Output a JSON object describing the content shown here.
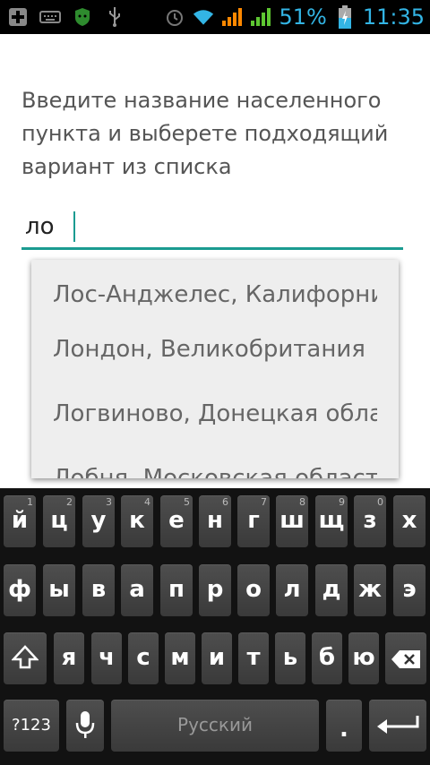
{
  "status_bar": {
    "battery_percent": "51%",
    "time": "11:35",
    "accent": "#33b5e5",
    "icons": [
      "add-icon",
      "keyboard-icon",
      "android-icon",
      "usb-icon",
      "alarm-icon",
      "wifi-icon",
      "signal-icon",
      "signal-icon",
      "battery-icon"
    ]
  },
  "instruction": "Введите название населенного пункта и выберете подходящий вариант из списка",
  "search": {
    "value": "ло",
    "accent": "#1b9b91"
  },
  "suggestions": [
    "Лос-Анджелес, Калифорния",
    "Лондон, Великобритания",
    "Логвиново, Донецкая область",
    "Лобня, Московская область"
  ],
  "keyboard": {
    "row1": [
      {
        "label": "й",
        "hint": "1"
      },
      {
        "label": "ц",
        "hint": "2"
      },
      {
        "label": "у",
        "hint": "3"
      },
      {
        "label": "к",
        "hint": "4"
      },
      {
        "label": "е",
        "hint": "5"
      },
      {
        "label": "н",
        "hint": "6"
      },
      {
        "label": "г",
        "hint": "7"
      },
      {
        "label": "ш",
        "hint": "8"
      },
      {
        "label": "щ",
        "hint": "9"
      },
      {
        "label": "з",
        "hint": "0"
      },
      {
        "label": "х",
        "hint": ""
      }
    ],
    "row2": [
      {
        "label": "ф"
      },
      {
        "label": "ы"
      },
      {
        "label": "в"
      },
      {
        "label": "а"
      },
      {
        "label": "п"
      },
      {
        "label": "р"
      },
      {
        "label": "о"
      },
      {
        "label": "л"
      },
      {
        "label": "д"
      },
      {
        "label": "ж"
      },
      {
        "label": "э"
      }
    ],
    "row3": [
      {
        "label": "я"
      },
      {
        "label": "ч"
      },
      {
        "label": "с"
      },
      {
        "label": "м"
      },
      {
        "label": "и"
      },
      {
        "label": "т"
      },
      {
        "label": "ь"
      },
      {
        "label": "б"
      },
      {
        "label": "ю"
      }
    ],
    "symbols_label": "?123",
    "space_label": "Русский",
    "period_label": "."
  }
}
